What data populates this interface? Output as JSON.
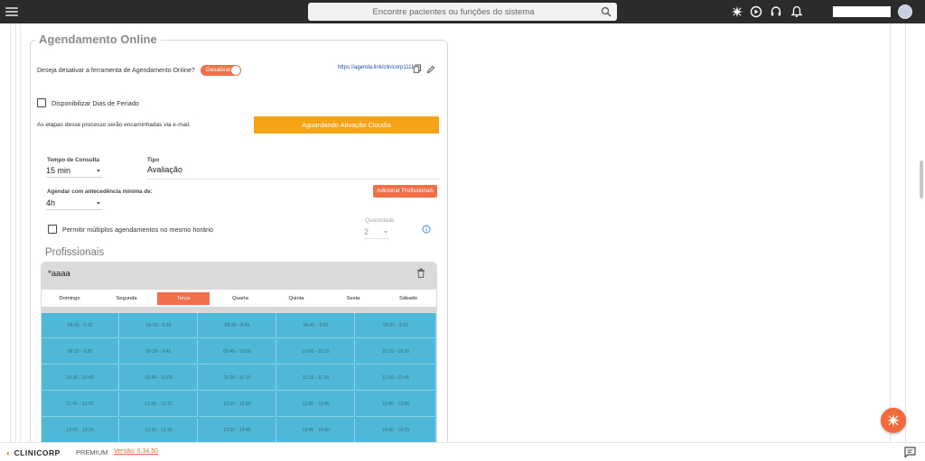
{
  "topbar": {
    "search_placeholder": "Encontre pacientes ou funções do sistema"
  },
  "section": {
    "title": "Agendamento Online",
    "deactivate_question": "Deseja desativar a ferramenta de Agendamento Online?",
    "toggle_label": "Desativar",
    "link": "https://agenda.link/clinicorp1111",
    "holiday_label": "Disponibilizar Dias de Feriado",
    "email_note": "As etapas desse processo serão encaminhadas via e-mail.",
    "activation_button": "Aguardando Ativação Cloudia"
  },
  "form": {
    "consult_time_label": "Tempo de Consulta",
    "consult_time_value": "15 min",
    "type_label": "Tipo",
    "type_value": "Avaliação",
    "advance_label": "Agendar com antecedência mínima de:",
    "advance_value": "4h",
    "add_professionals_button": "Adicionar Profissionais",
    "multiple_label": "Permitir múltiplos agendamentos no mesmo horário",
    "quantity_label": "Quantidade",
    "quantity_value": "2"
  },
  "professionals": {
    "title": "Profissionais",
    "card_name": "*aaaa",
    "days": [
      "Domingo",
      "Segunda",
      "Terça",
      "Quarta",
      "Quinta",
      "Sexta",
      "Sábado"
    ],
    "active_day": "Terça",
    "slots": [
      [
        "09:00 - 9:15",
        "09:15 - 9:30",
        "09:30 - 9:45",
        "09:45 - 9:00",
        "09:00 - 9:15"
      ],
      [
        "09:15 - 9:30",
        "09:30 - 9:45",
        "09:45 - 10:00",
        "10:00 - 10:15",
        "10:15 - 10:30"
      ],
      [
        "10:30 - 10:45",
        "10:45 - 11:00",
        "11:00 - 11:15",
        "11:15 - 11:30",
        "11:30 - 11:45"
      ],
      [
        "11:45 - 12:00",
        "12:00 - 12:15",
        "12:15 - 12:30",
        "12:30 - 12:45",
        "12:45 - 13:00"
      ],
      [
        "13:00 - 13:15",
        "13:15 - 13:30",
        "13:30 - 13:45",
        "13:45 - 14:00",
        "14:00 - 14:15"
      ]
    ]
  },
  "footer": {
    "brand": "CLINICORP",
    "plan": "PREMIUM",
    "version": "Versão: 0.34.50"
  },
  "colors": {
    "accent": "#f06a3a",
    "activation": "#f7a318",
    "grid": "#4fb7d8",
    "topbar": "#2b2b2b"
  }
}
